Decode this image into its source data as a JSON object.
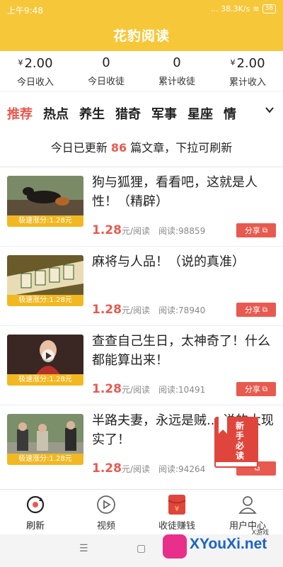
{
  "status_bar": {
    "time": "上午9:48",
    "network": "... 38.3K/s",
    "battery": "38"
  },
  "app_title": "花豹阅读",
  "stats": [
    {
      "value": "2.00",
      "currency": "¥",
      "label": "今日收入"
    },
    {
      "value": "0",
      "currency": "",
      "label": "今日收徒"
    },
    {
      "value": "0",
      "currency": "",
      "label": "累计收徒"
    },
    {
      "value": "2.00",
      "currency": "¥",
      "label": "累计收入"
    }
  ],
  "tabs": [
    "推荐",
    "热点",
    "养生",
    "猎奇",
    "军事",
    "星座",
    "情"
  ],
  "notice": {
    "before": "今日已更新",
    "count": "86",
    "after": "篇文章，下拉可刷新"
  },
  "articles": [
    {
      "title": "狗与狐狸，看看吧，这就是人性！（精辟）",
      "badge": "极速涨分:1.28元",
      "price": "1.28",
      "price_unit": "元/阅读",
      "reads": "阅读:98859",
      "share": "分享"
    },
    {
      "title": "麻将与人品！（说的真准）",
      "badge": "极速涨分:1.28元",
      "price": "1.28",
      "price_unit": "元/阅读",
      "reads": "阅读:78940",
      "share": "分享"
    },
    {
      "title": "查查自己生日，太神奇了！什么都能算出来！",
      "badge": "极速涨分:1.28元",
      "price": "1.28",
      "price_unit": "元/阅读",
      "reads": "阅读:10491",
      "share": "分享"
    },
    {
      "title": "半路夫妻，永远是贼... 说的太现实了！",
      "badge": "极速涨分:1.28元",
      "price": "1.28",
      "price_unit": "元/阅读",
      "reads": "阅读:94264",
      "share": ""
    }
  ],
  "floating_badge": {
    "line1": "新手",
    "line2": "必读"
  },
  "bottom_nav": [
    {
      "label": "刷新",
      "icon": "refresh-icon"
    },
    {
      "label": "视频",
      "icon": "play-icon"
    },
    {
      "label": "收徒赚钱",
      "icon": "red-envelope-icon"
    },
    {
      "label": "用户中心",
      "icon": "user-icon"
    }
  ],
  "watermark": {
    "main": "XYouXi.net",
    "sub": "X游戏"
  },
  "colors": {
    "brand": "#f7c73a",
    "accent": "#e85a4f",
    "badge": "#f2b821"
  }
}
